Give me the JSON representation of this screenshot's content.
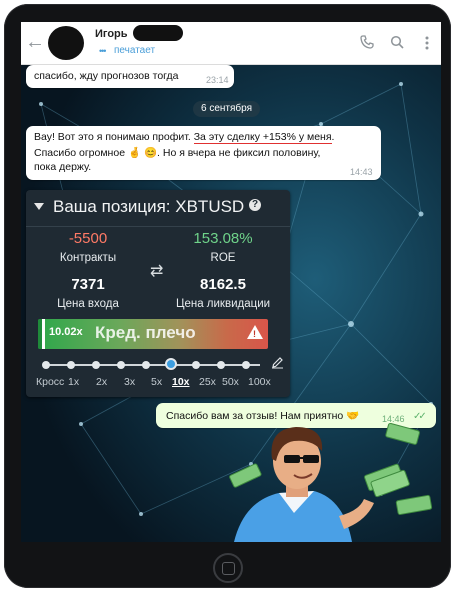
{
  "header": {
    "contact_name": "Игорь",
    "status": "печатает",
    "back_icon": "arrow-left-icon",
    "actions": [
      "phone-icon",
      "search-icon",
      "more-vert-icon"
    ]
  },
  "messages": {
    "m1": {
      "text": "спасибо, жду прогнозов тогда",
      "time": "23:14"
    },
    "date_separator": "6 сентября",
    "m2": {
      "line1_before": "Вау! Вот это я понимаю профит. ",
      "line1_highlight": "За эту сделку +153% у меня",
      "line1_after": ".",
      "line2": "Спасибо огромное 🤞 😊. Но я вчера не фиксил половину,",
      "line3": "пока держу.",
      "time": "14:43"
    },
    "m3": {
      "text": "Спасибо вам за отзыв! Нам приятно 🤝",
      "time": "14:46"
    }
  },
  "position_card": {
    "title": "Ваша позиция: XBTUSD",
    "help": "?",
    "contracts_value": "-5500",
    "contracts_label": "Контракты",
    "roe_value": "153.08%",
    "roe_label": "ROE",
    "entry_value": "7371",
    "entry_label": "Цена входа",
    "liq_value": "8162.5",
    "liq_label": "Цена ликвидации",
    "leverage_value": "10.02x",
    "leverage_label": "Кред. плечо",
    "leverage_ticks": [
      "Кросс",
      "1x",
      "2x",
      "3x",
      "5x",
      "10x",
      "25x",
      "50x",
      "100x"
    ],
    "leverage_selected": "10x"
  },
  "colors": {
    "negative": "#ff7a66",
    "positive": "#6fd38a",
    "link": "#4a9ed8",
    "accent": "#3c9ee0"
  }
}
